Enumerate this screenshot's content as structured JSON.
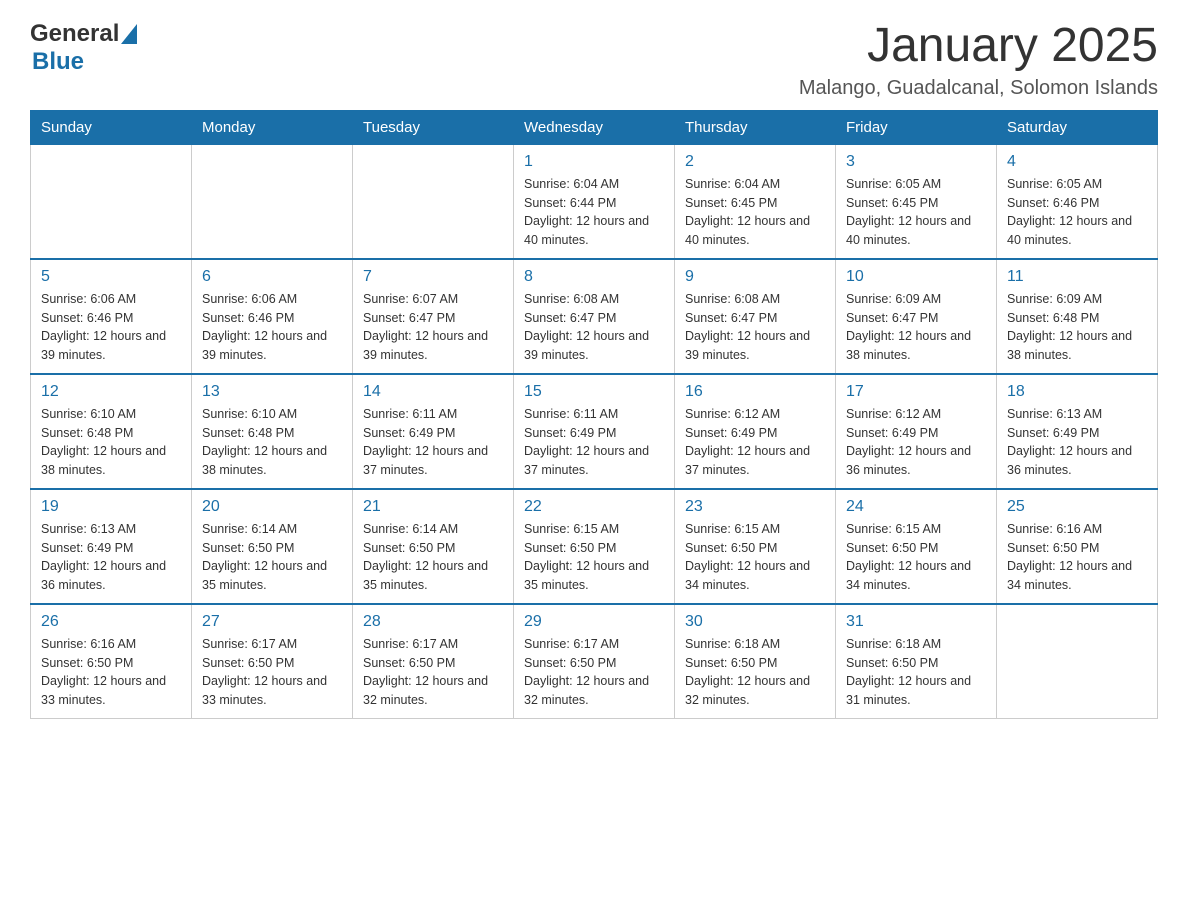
{
  "header": {
    "logo_general": "General",
    "logo_blue": "Blue",
    "month_title": "January 2025",
    "location": "Malango, Guadalcanal, Solomon Islands"
  },
  "days_of_week": [
    "Sunday",
    "Monday",
    "Tuesday",
    "Wednesday",
    "Thursday",
    "Friday",
    "Saturday"
  ],
  "weeks": [
    [
      {
        "day": "",
        "sunrise": "",
        "sunset": "",
        "daylight": ""
      },
      {
        "day": "",
        "sunrise": "",
        "sunset": "",
        "daylight": ""
      },
      {
        "day": "",
        "sunrise": "",
        "sunset": "",
        "daylight": ""
      },
      {
        "day": "1",
        "sunrise": "Sunrise: 6:04 AM",
        "sunset": "Sunset: 6:44 PM",
        "daylight": "Daylight: 12 hours and 40 minutes."
      },
      {
        "day": "2",
        "sunrise": "Sunrise: 6:04 AM",
        "sunset": "Sunset: 6:45 PM",
        "daylight": "Daylight: 12 hours and 40 minutes."
      },
      {
        "day": "3",
        "sunrise": "Sunrise: 6:05 AM",
        "sunset": "Sunset: 6:45 PM",
        "daylight": "Daylight: 12 hours and 40 minutes."
      },
      {
        "day": "4",
        "sunrise": "Sunrise: 6:05 AM",
        "sunset": "Sunset: 6:46 PM",
        "daylight": "Daylight: 12 hours and 40 minutes."
      }
    ],
    [
      {
        "day": "5",
        "sunrise": "Sunrise: 6:06 AM",
        "sunset": "Sunset: 6:46 PM",
        "daylight": "Daylight: 12 hours and 39 minutes."
      },
      {
        "day": "6",
        "sunrise": "Sunrise: 6:06 AM",
        "sunset": "Sunset: 6:46 PM",
        "daylight": "Daylight: 12 hours and 39 minutes."
      },
      {
        "day": "7",
        "sunrise": "Sunrise: 6:07 AM",
        "sunset": "Sunset: 6:47 PM",
        "daylight": "Daylight: 12 hours and 39 minutes."
      },
      {
        "day": "8",
        "sunrise": "Sunrise: 6:08 AM",
        "sunset": "Sunset: 6:47 PM",
        "daylight": "Daylight: 12 hours and 39 minutes."
      },
      {
        "day": "9",
        "sunrise": "Sunrise: 6:08 AM",
        "sunset": "Sunset: 6:47 PM",
        "daylight": "Daylight: 12 hours and 39 minutes."
      },
      {
        "day": "10",
        "sunrise": "Sunrise: 6:09 AM",
        "sunset": "Sunset: 6:47 PM",
        "daylight": "Daylight: 12 hours and 38 minutes."
      },
      {
        "day": "11",
        "sunrise": "Sunrise: 6:09 AM",
        "sunset": "Sunset: 6:48 PM",
        "daylight": "Daylight: 12 hours and 38 minutes."
      }
    ],
    [
      {
        "day": "12",
        "sunrise": "Sunrise: 6:10 AM",
        "sunset": "Sunset: 6:48 PM",
        "daylight": "Daylight: 12 hours and 38 minutes."
      },
      {
        "day": "13",
        "sunrise": "Sunrise: 6:10 AM",
        "sunset": "Sunset: 6:48 PM",
        "daylight": "Daylight: 12 hours and 38 minutes."
      },
      {
        "day": "14",
        "sunrise": "Sunrise: 6:11 AM",
        "sunset": "Sunset: 6:49 PM",
        "daylight": "Daylight: 12 hours and 37 minutes."
      },
      {
        "day": "15",
        "sunrise": "Sunrise: 6:11 AM",
        "sunset": "Sunset: 6:49 PM",
        "daylight": "Daylight: 12 hours and 37 minutes."
      },
      {
        "day": "16",
        "sunrise": "Sunrise: 6:12 AM",
        "sunset": "Sunset: 6:49 PM",
        "daylight": "Daylight: 12 hours and 37 minutes."
      },
      {
        "day": "17",
        "sunrise": "Sunrise: 6:12 AM",
        "sunset": "Sunset: 6:49 PM",
        "daylight": "Daylight: 12 hours and 36 minutes."
      },
      {
        "day": "18",
        "sunrise": "Sunrise: 6:13 AM",
        "sunset": "Sunset: 6:49 PM",
        "daylight": "Daylight: 12 hours and 36 minutes."
      }
    ],
    [
      {
        "day": "19",
        "sunrise": "Sunrise: 6:13 AM",
        "sunset": "Sunset: 6:49 PM",
        "daylight": "Daylight: 12 hours and 36 minutes."
      },
      {
        "day": "20",
        "sunrise": "Sunrise: 6:14 AM",
        "sunset": "Sunset: 6:50 PM",
        "daylight": "Daylight: 12 hours and 35 minutes."
      },
      {
        "day": "21",
        "sunrise": "Sunrise: 6:14 AM",
        "sunset": "Sunset: 6:50 PM",
        "daylight": "Daylight: 12 hours and 35 minutes."
      },
      {
        "day": "22",
        "sunrise": "Sunrise: 6:15 AM",
        "sunset": "Sunset: 6:50 PM",
        "daylight": "Daylight: 12 hours and 35 minutes."
      },
      {
        "day": "23",
        "sunrise": "Sunrise: 6:15 AM",
        "sunset": "Sunset: 6:50 PM",
        "daylight": "Daylight: 12 hours and 34 minutes."
      },
      {
        "day": "24",
        "sunrise": "Sunrise: 6:15 AM",
        "sunset": "Sunset: 6:50 PM",
        "daylight": "Daylight: 12 hours and 34 minutes."
      },
      {
        "day": "25",
        "sunrise": "Sunrise: 6:16 AM",
        "sunset": "Sunset: 6:50 PM",
        "daylight": "Daylight: 12 hours and 34 minutes."
      }
    ],
    [
      {
        "day": "26",
        "sunrise": "Sunrise: 6:16 AM",
        "sunset": "Sunset: 6:50 PM",
        "daylight": "Daylight: 12 hours and 33 minutes."
      },
      {
        "day": "27",
        "sunrise": "Sunrise: 6:17 AM",
        "sunset": "Sunset: 6:50 PM",
        "daylight": "Daylight: 12 hours and 33 minutes."
      },
      {
        "day": "28",
        "sunrise": "Sunrise: 6:17 AM",
        "sunset": "Sunset: 6:50 PM",
        "daylight": "Daylight: 12 hours and 32 minutes."
      },
      {
        "day": "29",
        "sunrise": "Sunrise: 6:17 AM",
        "sunset": "Sunset: 6:50 PM",
        "daylight": "Daylight: 12 hours and 32 minutes."
      },
      {
        "day": "30",
        "sunrise": "Sunrise: 6:18 AM",
        "sunset": "Sunset: 6:50 PM",
        "daylight": "Daylight: 12 hours and 32 minutes."
      },
      {
        "day": "31",
        "sunrise": "Sunrise: 6:18 AM",
        "sunset": "Sunset: 6:50 PM",
        "daylight": "Daylight: 12 hours and 31 minutes."
      },
      {
        "day": "",
        "sunrise": "",
        "sunset": "",
        "daylight": ""
      }
    ]
  ]
}
